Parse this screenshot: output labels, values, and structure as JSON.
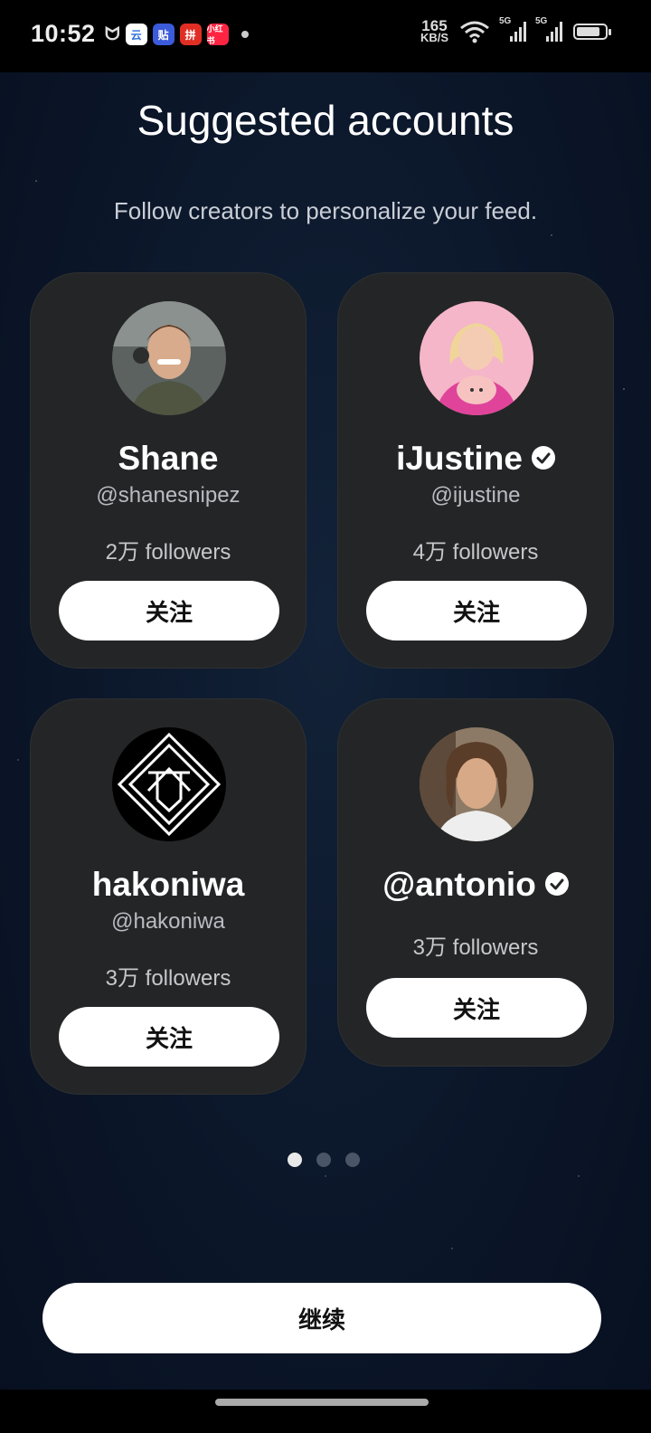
{
  "status_bar": {
    "time": "10:52",
    "net_speed_value": "165",
    "net_speed_unit": "KB/S",
    "signal_1": "5G",
    "signal_2": "5G",
    "app_icons": [
      "xiaomi-icon",
      "yun-app-icon",
      "tieba-app-icon",
      "pinduoduo-app-icon",
      "xiaohongshu-app-icon"
    ]
  },
  "header": {
    "title": "Suggested accounts",
    "subtitle": "Follow creators to personalize your feed."
  },
  "cards": [
    {
      "name": "Shane",
      "handle": "@shanesnipez",
      "followers": "2万 followers",
      "verified": false,
      "button": "关注"
    },
    {
      "name": "iJustine",
      "handle": "@ijustine",
      "followers": "4万 followers",
      "verified": true,
      "button": "关注"
    },
    {
      "name": "hakoniwa",
      "handle": "@hakoniwa",
      "followers": "3万 followers",
      "verified": false,
      "button": "关注"
    },
    {
      "name": "@antonio",
      "handle": "",
      "followers": "3万 followers",
      "verified": true,
      "button": "关注"
    }
  ],
  "pagination": {
    "total": 3,
    "active": 1
  },
  "footer": {
    "continue_label": "继续"
  },
  "colors": {
    "background": "#0b1629",
    "card": "#242526",
    "button": "#ffffff",
    "dot_active": "#e8e8e8",
    "dot_inactive": "#4a5568"
  }
}
